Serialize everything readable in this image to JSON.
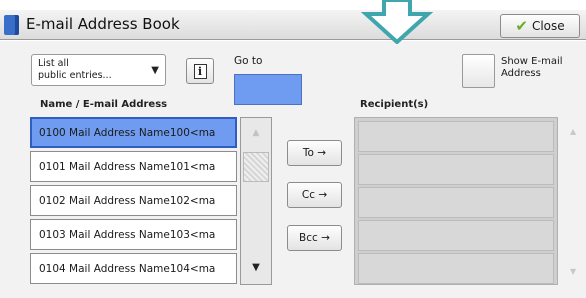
{
  "window": {
    "title": "E-mail Address Book",
    "close_label": "Close"
  },
  "controls": {
    "list_select_value": "List all\npublic entries...",
    "info_glyph": "i",
    "goto_label": "Go to",
    "goto_value": "",
    "show_email_label": "Show E-mail\nAddress",
    "show_email_checked": false
  },
  "headers": {
    "name_email": "Name / E-mail Address",
    "recipients": "Recipient(s)"
  },
  "address_list": {
    "selected_index": 0,
    "items": [
      "0100  Mail Address Name100<ma",
      "0101  Mail Address Name101<ma",
      "0102  Mail Address Name102<ma",
      "0103  Mail Address Name103<ma",
      "0104  Mail Address Name104<ma"
    ]
  },
  "buttons": {
    "to": "To →",
    "cc": "Cc →",
    "bcc": "Bcc →"
  },
  "recipients": [],
  "icons": {
    "title": "address-book-icon",
    "close": "checkmark-icon",
    "arrow": "down-arrow-icon",
    "select": "dropdown-arrow-icon",
    "scroll_up": "scroll-up-icon",
    "scroll_down": "scroll-down-icon"
  },
  "colors": {
    "accent": "#6f9cf0",
    "arrow": "#3fa6ad",
    "check": "#6cad2a"
  }
}
